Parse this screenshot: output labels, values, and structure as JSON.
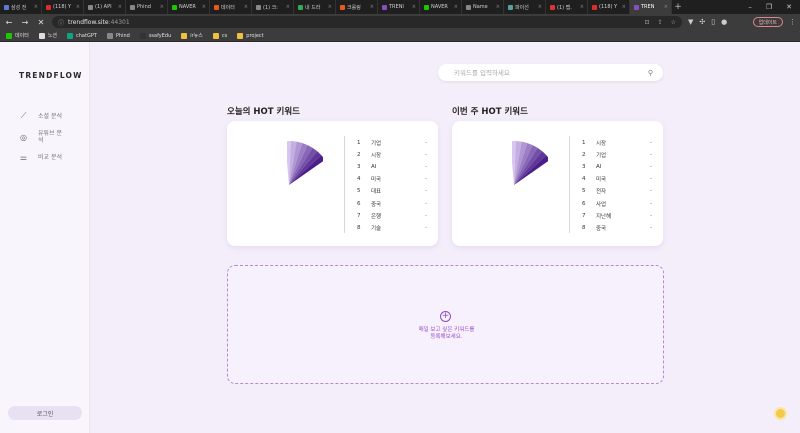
{
  "browser": {
    "tabs": [
      {
        "label": "삼성 전",
        "color": "#5b7bd5"
      },
      {
        "label": "(118) Y",
        "color": "#e02b2b"
      },
      {
        "label": "(1) API",
        "color": "#888888"
      },
      {
        "label": "Phind",
        "color": "#888888"
      },
      {
        "label": "NAVER",
        "color": "#1ec800"
      },
      {
        "label": "데이터",
        "color": "#e8591a"
      },
      {
        "label": "(1) 크:",
        "color": "#888888"
      },
      {
        "label": "내 드라",
        "color": "#34a853"
      },
      {
        "label": "크롤링",
        "color": "#e8591a"
      },
      {
        "label": "TRENI",
        "color": "#8a4dc0"
      },
      {
        "label": "NAVER",
        "color": "#1ec800"
      },
      {
        "label": "Name",
        "color": "#888888"
      },
      {
        "label": "파이선",
        "color": "#5aa0a0"
      },
      {
        "label": "(1) 맵.",
        "color": "#d33"
      },
      {
        "label": "(118) Y",
        "color": "#e02b2b"
      },
      {
        "label": "TREN",
        "color": "#8a4dc0",
        "active": true
      }
    ],
    "url_host": "trendflow.site",
    "url_port": ":44301",
    "profile_button": "업데이트",
    "bookmarks": [
      {
        "label": "데이터",
        "color": "#1ec800"
      },
      {
        "label": "노션",
        "color": "#dddddd"
      },
      {
        "label": "chatGPT",
        "color": "#10a37f"
      },
      {
        "label": "Phind",
        "color": "#888888"
      },
      {
        "label": "ssafyEdu",
        "color": "#333333"
      },
      {
        "label": "ir뉴스",
        "color": "#f0c040"
      },
      {
        "label": "cs",
        "color": "#f0c040"
      },
      {
        "label": "project",
        "color": "#f0c040"
      }
    ]
  },
  "app": {
    "logo": "TRENDFLOW",
    "sidebar": [
      {
        "label": "소셜 분석",
        "icon": "chart-line-icon"
      },
      {
        "label": "유튜브 분석",
        "icon": "youtube-circle-icon"
      },
      {
        "label": "비교 분석",
        "icon": "sliders-icon"
      }
    ],
    "login": "로그인",
    "search_placeholder": "키워드를 입력하세요",
    "today": {
      "title": "오늘의 HOT 키워드",
      "keywords": [
        "기업",
        "시장",
        "AI",
        "미국",
        "대표",
        "중국",
        "은행",
        "기술"
      ]
    },
    "week": {
      "title": "이번 주 HOT 키워드",
      "keywords": [
        "시장",
        "기업",
        "AI",
        "미국",
        "전자",
        "사업",
        "지난해",
        "중국"
      ]
    },
    "rank_change": "-",
    "add_box": {
      "line1": "매일 보고 싶은 키워드를",
      "line2": "등록해보세요."
    },
    "colors": {
      "accent": "#8a4dc0",
      "fan_dark": "#4b1f8a",
      "fan_light": "#d9c6f0"
    }
  }
}
